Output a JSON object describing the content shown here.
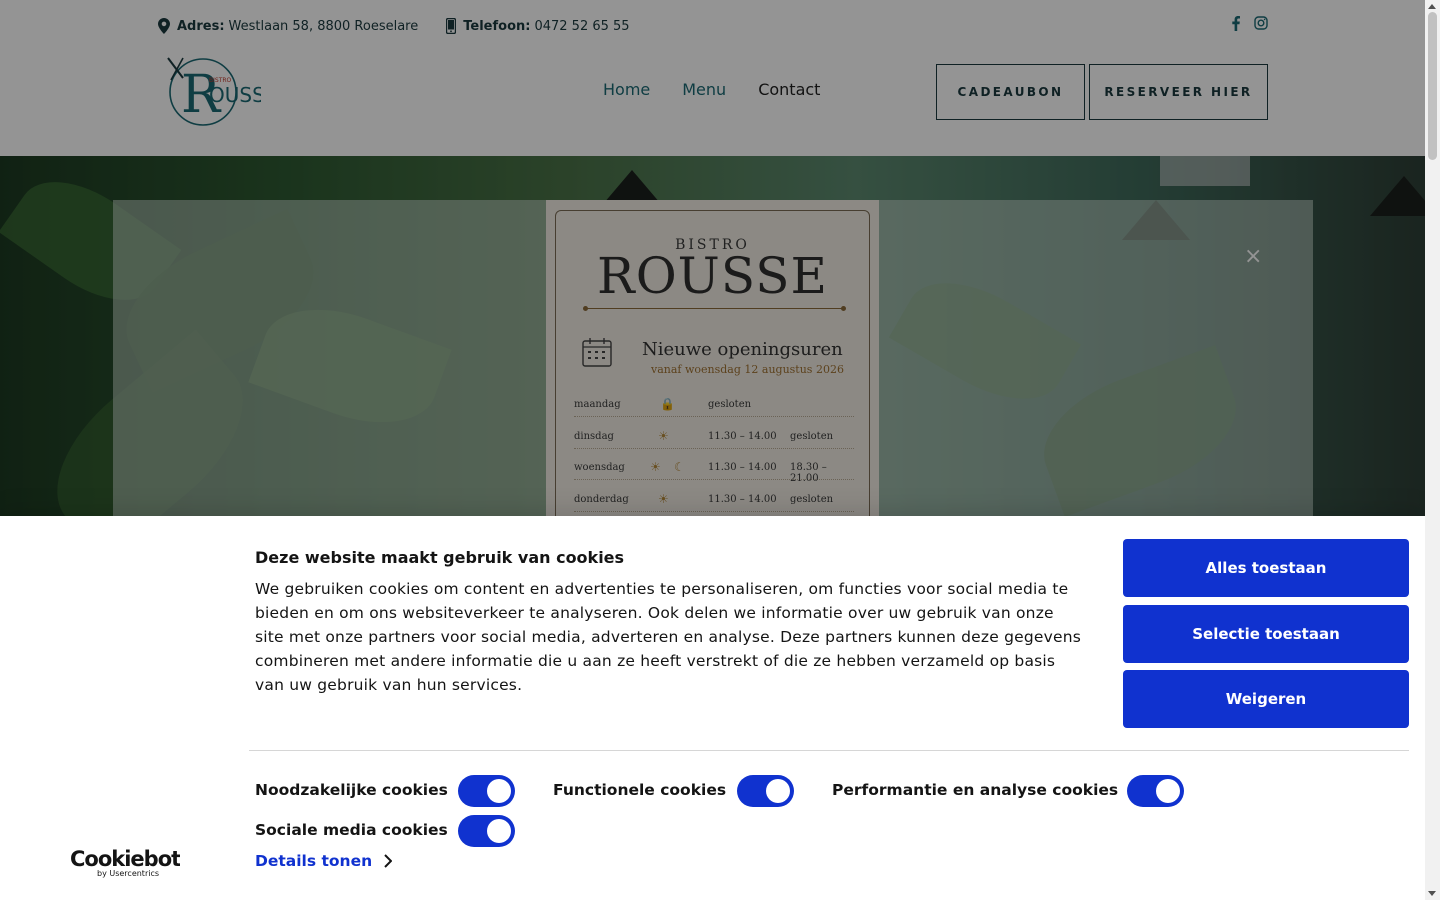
{
  "topbar": {
    "address_label": "Adres:",
    "address_value": "Westlaan 58, 8800 Roeselare",
    "phone_label": "Telefoon:",
    "phone_value": "0472 52 65 55"
  },
  "nav": {
    "items": [
      "Home",
      "Menu",
      "Contact"
    ]
  },
  "header_buttons": {
    "gift": "CADEAUBON",
    "book": "RESERVEER HIER"
  },
  "popup": {
    "bistro": "BISTRO",
    "name": "ROUSSE",
    "title": "Nieuwe openingsuren",
    "subtitle": "vanaf woensdag 12 augustus 2026",
    "rows": [
      {
        "day": "maandag",
        "lunch": "gesloten",
        "dinner": ""
      },
      {
        "day": "dinsdag",
        "lunch": "11.30 – 14.00",
        "dinner": "gesloten"
      },
      {
        "day": "woensdag",
        "lunch": "11.30 – 14.00",
        "dinner": "18.30 – 21.00"
      },
      {
        "day": "donderdag",
        "lunch": "11.30 – 14.00",
        "dinner": "gesloten"
      }
    ],
    "close": "×"
  },
  "cookie": {
    "title": "Deze website maakt gebruik van cookies",
    "text": "We gebruiken cookies om content en advertenties te personaliseren, om functies voor social media te bieden en om ons websiteverkeer te analyseren. Ook delen we informatie over uw gebruik van onze site met onze partners voor social media, adverteren en analyse. Deze partners kunnen deze gegevens combineren met andere informatie die u aan ze heeft verstrekt of die ze hebben verzameld op basis van uw gebruik van hun services.",
    "allow_all": "Alles toestaan",
    "allow_selection": "Selectie toestaan",
    "deny": "Weigeren",
    "toggles": {
      "necessary": "Noodzakelijke cookies",
      "functional": "Functionele cookies",
      "performance": "Performantie en analyse cookies",
      "social": "Sociale media cookies"
    },
    "details": "Details tonen",
    "brand": "Cookiebot",
    "brand_sub": "by Usercentrics"
  },
  "colors": {
    "accent": "#1032cf",
    "brand_teal": "#1b6a74",
    "dark": "#1b3a3f"
  }
}
